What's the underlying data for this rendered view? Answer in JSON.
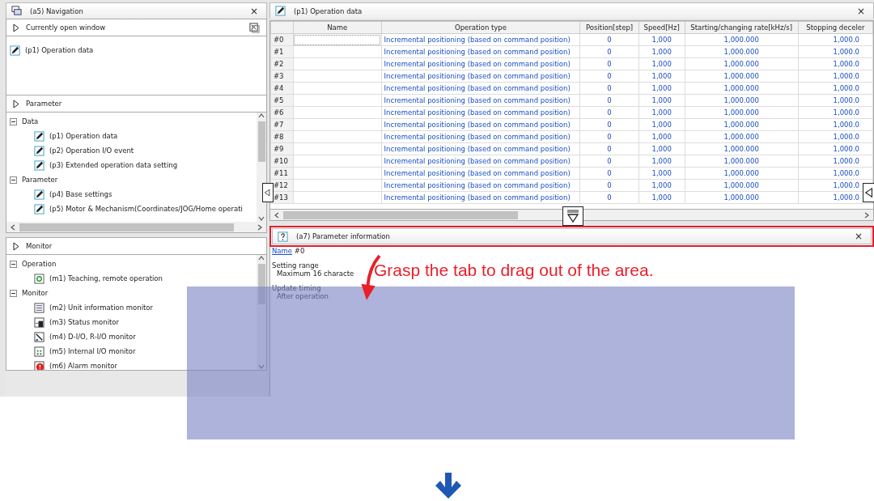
{
  "navigation": {
    "title": "(a5) Navigation",
    "close": "×",
    "open_window": {
      "label": "Currently open window",
      "items": [
        {
          "label": "(p1) Operation data",
          "kind": "edit"
        }
      ]
    },
    "parameter": {
      "label": "Parameter",
      "groups": [
        {
          "label": "Data",
          "expanded": true,
          "children": [
            {
              "label": "(p1) Operation data",
              "kind": "edit"
            },
            {
              "label": "(p2) Operation I/O event",
              "kind": "edit"
            },
            {
              "label": "(p3) Extended operation data setting",
              "kind": "edit"
            }
          ]
        },
        {
          "label": "Parameter",
          "expanded": true,
          "children": [
            {
              "label": "(p4) Base settings",
              "kind": "edit"
            },
            {
              "label": "(p5) Motor & Mechanism(Coordinates/JOG/Home operati",
              "kind": "edit"
            }
          ]
        }
      ]
    },
    "monitor": {
      "label": "Monitor",
      "groups": [
        {
          "label": "Operation",
          "expanded": true,
          "children": [
            {
              "label": "(m1) Teaching, remote operation",
              "kind": "teaching"
            }
          ]
        },
        {
          "label": "Monitor",
          "expanded": true,
          "children": [
            {
              "label": "(m2) Unit information monitor",
              "kind": "list"
            },
            {
              "label": "(m3) Status monitor",
              "kind": "status"
            },
            {
              "label": "(m4) D-I/O, R-I/O monitor",
              "kind": "wiring"
            },
            {
              "label": "(m5) Internal I/O monitor",
              "kind": "grid"
            },
            {
              "label": "(m6) Alarm monitor",
              "kind": "alarm"
            }
          ]
        }
      ]
    }
  },
  "operation_data": {
    "title": "(p1) Operation data",
    "close": "×",
    "columns": [
      "Name",
      "Operation type",
      "Position[step]",
      "Speed[Hz]",
      "Starting/changing rate[kHz/s]",
      "Stopping deceler"
    ],
    "rows": [
      {
        "label": "#0",
        "selected": true,
        "cells": [
          "",
          "Incremental positioning (based on command position)",
          "0",
          "1,000",
          "1,000.000",
          "1,000.0"
        ]
      },
      {
        "label": "#1",
        "selected": false,
        "cells": [
          "",
          "Incremental positioning (based on command position)",
          "0",
          "1,000",
          "1,000.000",
          "1,000.0"
        ]
      },
      {
        "label": "#2",
        "selected": false,
        "cells": [
          "",
          "Incremental positioning (based on command position)",
          "0",
          "1,000",
          "1,000.000",
          "1,000.0"
        ]
      },
      {
        "label": "#3",
        "selected": false,
        "cells": [
          "",
          "Incremental positioning (based on command position)",
          "0",
          "1,000",
          "1,000.000",
          "1,000.0"
        ]
      },
      {
        "label": "#4",
        "selected": false,
        "cells": [
          "",
          "Incremental positioning (based on command position)",
          "0",
          "1,000",
          "1,000.000",
          "1,000.0"
        ]
      },
      {
        "label": "#5",
        "selected": false,
        "cells": [
          "",
          "Incremental positioning (based on command position)",
          "0",
          "1,000",
          "1,000.000",
          "1,000.0"
        ]
      },
      {
        "label": "#6",
        "selected": false,
        "cells": [
          "",
          "Incremental positioning (based on command position)",
          "0",
          "1,000",
          "1,000.000",
          "1,000.0"
        ]
      },
      {
        "label": "#7",
        "selected": false,
        "cells": [
          "",
          "Incremental positioning (based on command position)",
          "0",
          "1,000",
          "1,000.000",
          "1,000.0"
        ]
      },
      {
        "label": "#8",
        "selected": false,
        "cells": [
          "",
          "Incremental positioning (based on command position)",
          "0",
          "1,000",
          "1,000.000",
          "1,000.0"
        ]
      },
      {
        "label": "#9",
        "selected": false,
        "cells": [
          "",
          "Incremental positioning (based on command position)",
          "0",
          "1,000",
          "1,000.000",
          "1,000.0"
        ]
      },
      {
        "label": "#10",
        "selected": false,
        "cells": [
          "",
          "Incremental positioning (based on command position)",
          "0",
          "1,000",
          "1,000.000",
          "1,000.0"
        ]
      },
      {
        "label": "#11",
        "selected": false,
        "cells": [
          "",
          "Incremental positioning (based on command position)",
          "0",
          "1,000",
          "1,000.000",
          "1,000.0"
        ]
      },
      {
        "label": "#12",
        "selected": false,
        "cells": [
          "",
          "Incremental positioning (based on command position)",
          "0",
          "1,000",
          "1,000.000",
          "1,000.0"
        ]
      },
      {
        "label": "#13",
        "selected": false,
        "cells": [
          "",
          "Incremental positioning (based on command position)",
          "0",
          "1,000",
          "1,000.000",
          "1,000.0"
        ]
      }
    ]
  },
  "parameter_information": {
    "title": "(a7) Parameter information",
    "close": "×",
    "name_link": "Name",
    "name_value": "#0",
    "sections": [
      {
        "heading": "Setting range",
        "value": "Maximum 16 characte"
      },
      {
        "heading": "Update timing",
        "value": "After operation"
      }
    ]
  },
  "annotation": {
    "text": "Grasp the tab to drag out of the area."
  }
}
